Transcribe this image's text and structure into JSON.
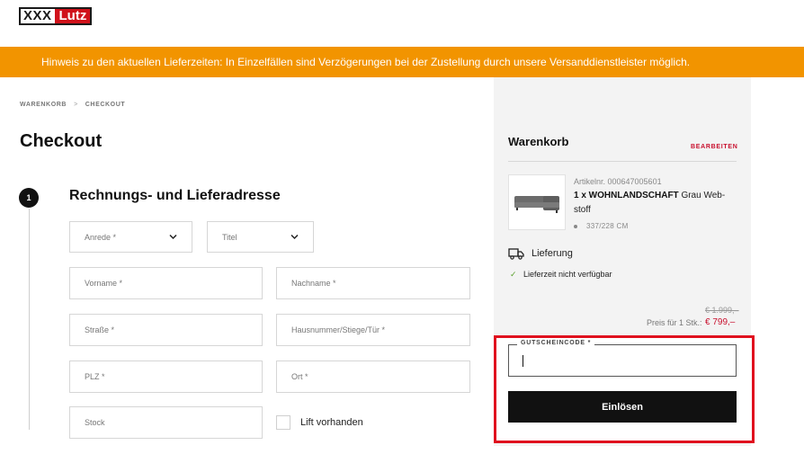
{
  "logo": {
    "part1": "XXX",
    "part2": "Lutz"
  },
  "banner": {
    "text": "Hinweis zu den aktuellen Lieferzeiten: In Einzelfällen sind Verzögerungen bei der Zustellung durch unsere Versanddienstleister möglich."
  },
  "breadcrumb": {
    "items": [
      "WARENKORB",
      "CHECKOUT"
    ],
    "separator": ">"
  },
  "page": {
    "title": "Checkout"
  },
  "step": {
    "number": "1",
    "title": "Rechnungs- und Lieferadresse"
  },
  "form": {
    "salutation": "Anrede *",
    "title": "Titel",
    "first_name": "Vorname *",
    "last_name": "Nachname *",
    "street": "Straße *",
    "house_number": "Hausnummer/Stiege/Tür *",
    "zip": "PLZ *",
    "city": "Ort *",
    "floor": "Stock",
    "elevator_label": "Lift vorhanden"
  },
  "cart": {
    "title": "Warenkorb",
    "edit_label": "BEARBEITEN",
    "item": {
      "article_nr": "Artikelnr. 000647005601",
      "quantity_name": "1 x WOHNLANDSCHAFT",
      "description": "Grau Web-stoff",
      "dimensions": "337/228 CM"
    },
    "delivery_label": "Lieferung",
    "availability": "Lieferzeit nicht verfügbar",
    "old_price": "€ 1.999,–",
    "price_label": "Preis für 1 Stk.:",
    "new_price": "€ 799,–"
  },
  "voucher": {
    "label": "GUTSCHEINCODE *",
    "value": "",
    "button": "Einlösen"
  },
  "colors": {
    "accent": "#f29400",
    "brand_red": "#d0121b",
    "price_red": "#c8102e",
    "highlight": "#e0101e"
  }
}
